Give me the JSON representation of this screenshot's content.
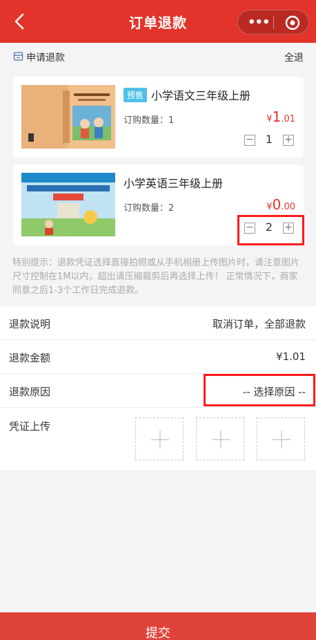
{
  "header": {
    "title": "订单退款",
    "more_icon": "more-dots-icon",
    "target_icon": "target-icon"
  },
  "apply": {
    "label": "申请退款",
    "all_label": "全退"
  },
  "products": [
    {
      "tag": "预售",
      "name": "小学语文三年级上册",
      "qty_label": "订购数量：1",
      "currency": "¥",
      "price_int": "1",
      "price_dec": ".01",
      "count": "1"
    },
    {
      "tag": "",
      "name": "小学英语三年级上册",
      "qty_label": "订购数量：2",
      "currency": "¥",
      "price_int": "0",
      "price_dec": ".00",
      "count": "2"
    }
  ],
  "notice": "特别提示：退款凭证选择直接拍照或从手机相册上传图片时，请注意图片尺寸控制在1M以内，超出请压缩裁剪后再选择上传！ 正常情况下，商家同意之后1-3个工作日完成退款。",
  "form": {
    "desc_label": "退款说明",
    "desc_value": "取消订单，全部退款",
    "amount_label": "退款金额",
    "amount_value": "¥1.01",
    "reason_label": "退款原因",
    "reason_value": "-- 选择原因 --",
    "upload_label": "凭证上传"
  },
  "submit_label": "提交",
  "colors": {
    "brand": "#e3342b",
    "tag": "#4fc1e9",
    "highlight": "#ff1a1a"
  }
}
